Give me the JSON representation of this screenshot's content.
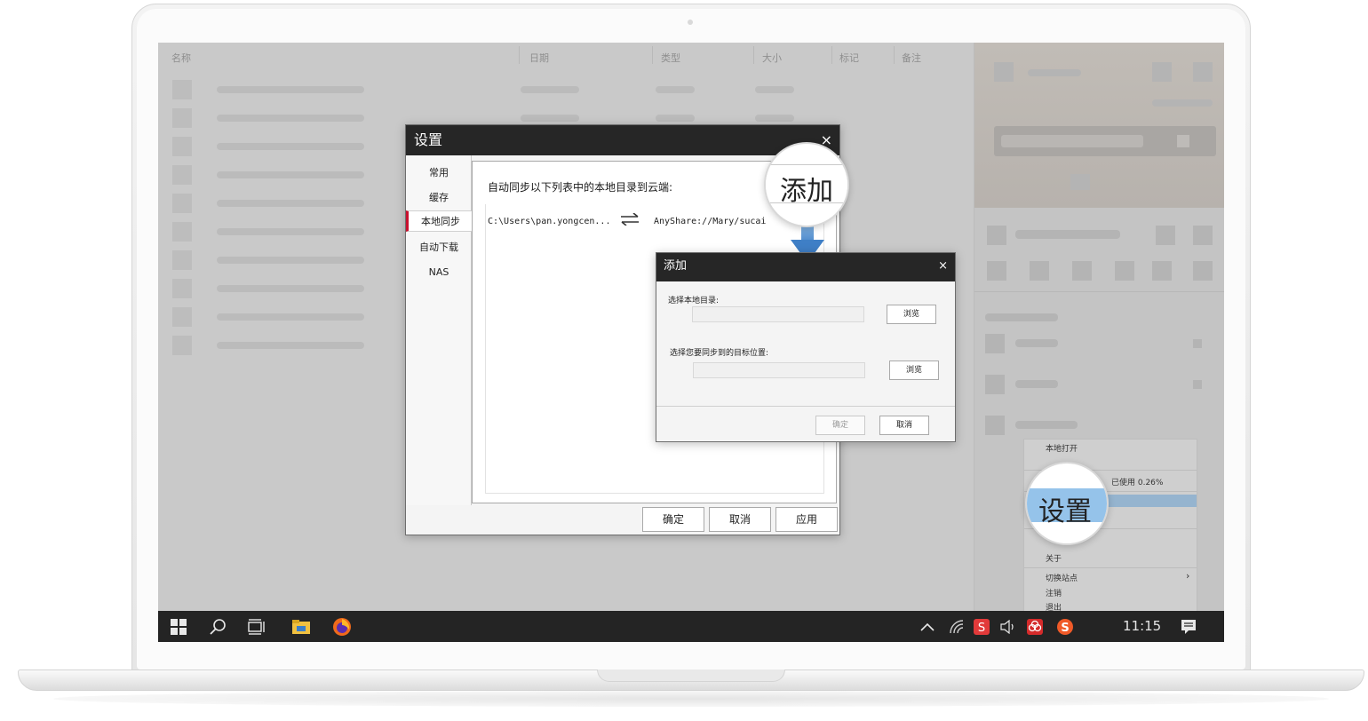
{
  "file_list": {
    "columns": [
      "名称",
      "日期",
      "类型",
      "大小",
      "标记",
      "备注"
    ]
  },
  "settings_dialog": {
    "title": "设置",
    "close": "×",
    "nav": [
      "常用",
      "缓存",
      "本地同步",
      "自动下载",
      "NAS"
    ],
    "active_nav": "本地同步",
    "heading": "自动同步以下列表中的本地目录到云端:",
    "sync_row": {
      "local_path": "C:\\Users\\pan.yongcen...",
      "cloud_path": "AnyShare://Mary/sucai"
    },
    "buttons": {
      "ok": "确定",
      "cancel": "取消",
      "apply": "应用"
    }
  },
  "add_dialog": {
    "title": "添加",
    "close": "×",
    "local_label": "选择本地目录:",
    "target_label": "选择您要同步到的目标位置:",
    "browse": "浏览",
    "ok": "确定",
    "cancel": "取消"
  },
  "callouts": {
    "add": "添加",
    "settings": "设置"
  },
  "tray_menu": {
    "open_local": "本地打开",
    "usage": "已使用 0.26%",
    "about": "关于",
    "switch_site": "切换站点",
    "logout": "注销",
    "exit": "退出",
    "submenu_arrow": "›"
  },
  "taskbar": {
    "time": "11:15",
    "icons": [
      "windows-start-icon",
      "search-icon",
      "task-view-icon",
      "file-explorer-icon",
      "firefox-icon",
      "chevron-up-icon",
      "wifi-icon",
      "sogou-input-icon",
      "volume-icon",
      "anyshare-tray-icon",
      "sogou-s-icon",
      "notification-icon"
    ]
  },
  "colors": {
    "accent_red": "#c8102e",
    "title_bar": "#262626",
    "arrow_blue": "#3f7fc6",
    "menu_highlight": "#95b4cf"
  }
}
